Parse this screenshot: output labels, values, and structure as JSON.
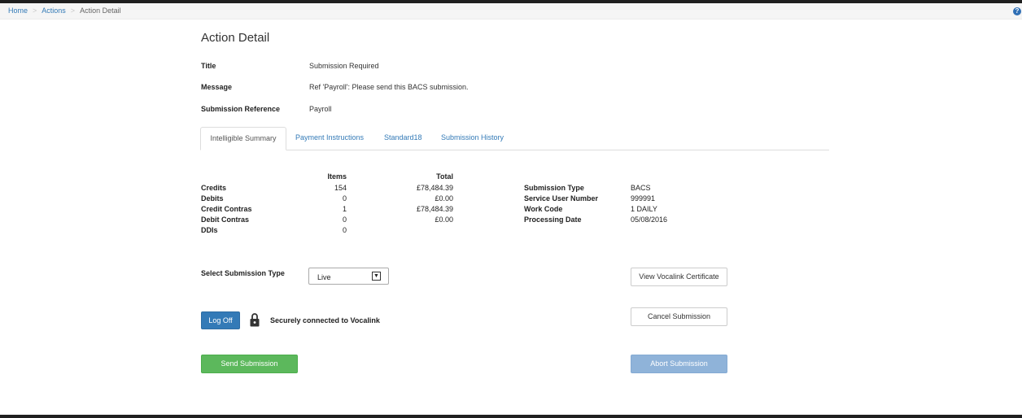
{
  "breadcrumb": {
    "items": [
      "Home",
      "Actions",
      "Action Detail"
    ],
    "separator": ">"
  },
  "help_icon": "question-circle-icon",
  "page": {
    "title": "Action Detail",
    "fields": [
      {
        "label": "Title",
        "value": "Submission Required"
      },
      {
        "label": "Message",
        "value": "Ref 'Payroll': Please send this BACS submission."
      },
      {
        "label": "Submission Reference",
        "value": "Payroll"
      }
    ]
  },
  "tabs": [
    "Intelligible Summary",
    "Payment Instructions",
    "Standard18",
    "Submission History"
  ],
  "summary": {
    "items_header": "Items",
    "total_header": "Total",
    "rows": [
      {
        "label": "Credits",
        "items": "154",
        "total": "£78,484.39"
      },
      {
        "label": "Debits",
        "items": "0",
        "total": "£0.00"
      },
      {
        "label": "Credit Contras",
        "items": "1",
        "total": "£78,484.39"
      },
      {
        "label": "Debit Contras",
        "items": "0",
        "total": "£0.00"
      },
      {
        "label": "DDIs",
        "items": "0",
        "total": ""
      }
    ]
  },
  "submission_info": [
    {
      "label": "Submission Type",
      "value": "BACS"
    },
    {
      "label": "Service User Number",
      "value": "999991"
    },
    {
      "label": "Work Code",
      "value": "1 DAILY"
    },
    {
      "label": "Processing Date",
      "value": "05/08/2016"
    }
  ],
  "controls": {
    "select_label": "Select Submission Type",
    "select_value": "Live",
    "view_certificate": "View Vocalink Certificate",
    "log_off": "Log Off",
    "secure_text": "Securely connected to Vocalink",
    "cancel_submission": "Cancel Submission",
    "send_submission": "Send Submission",
    "abort_submission": "Abort Submission"
  },
  "colors": {
    "link": "#337ab7",
    "primary": "#337ab7",
    "success": "#5cb85c",
    "disabled": "#8fb3d9"
  }
}
